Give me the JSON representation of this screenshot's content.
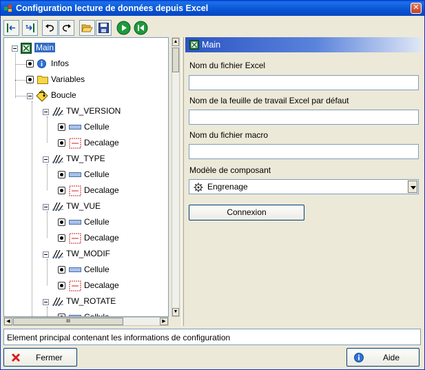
{
  "window": {
    "title": "Configuration lecture de données depuis Excel",
    "close_glyph": "✕"
  },
  "toolbar": {
    "buttons": [
      {
        "name": "move-left-button",
        "icon": "arrow-left-icon"
      },
      {
        "name": "move-right-button",
        "icon": "arrow-right-icon"
      },
      {
        "name": "undo-button",
        "icon": "undo-icon"
      },
      {
        "name": "redo-button",
        "icon": "redo-icon"
      },
      {
        "name": "open-button",
        "icon": "folder-open-icon"
      },
      {
        "name": "save-button",
        "icon": "save-icon"
      },
      {
        "name": "run-button",
        "icon": "play-icon"
      },
      {
        "name": "rewind-button",
        "icon": "rewind-icon"
      }
    ]
  },
  "tree": {
    "nodes": {
      "main": "Main",
      "infos": "Infos",
      "variables": "Variables",
      "boucle": "Boucle",
      "tw_version": "TW_VERSION",
      "tw_type": "TW_TYPE",
      "tw_vue": "TW_VUE",
      "tw_modif": "TW_MODIF",
      "tw_rotate": "TW_ROTATE",
      "cellule": "Cellule",
      "decalage": "Decalage"
    },
    "hscroll_thumb_glyph": "III"
  },
  "properties": {
    "header": "Main",
    "excel_file_label": "Nom du fichier Excel",
    "excel_file_value": "",
    "default_sheet_label": "Nom de la feuille de travail Excel par défaut",
    "default_sheet_value": "",
    "macro_file_label": "Nom du fichier macro",
    "macro_file_value": "",
    "component_model_label": "Modèle de composant",
    "component_model_value": "Engrenage",
    "connect_label": "Connexion"
  },
  "status": {
    "text": "Element principal contenant les informations de configuration"
  },
  "footer": {
    "close_label": "Fermer",
    "help_label": "Aide"
  },
  "colors": {
    "selection": "#316ac5",
    "titlebar": "#0854d4",
    "window_bg": "#ece9d8"
  }
}
